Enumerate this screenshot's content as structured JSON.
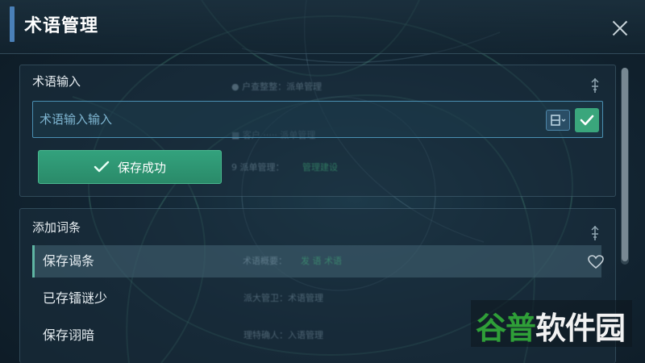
{
  "dialog": {
    "title": "术语管理",
    "close_icon": "close-icon"
  },
  "term_input_panel": {
    "title": "术语输入",
    "pin_icon": "pin-icon",
    "input": {
      "value": "",
      "placeholder": "术语输入输入"
    },
    "layout_icon": "layout-select-icon",
    "confirm_icon": "check-icon",
    "save_button_label": "保存成功"
  },
  "add_entry_panel": {
    "title": "添加词条",
    "pin_icon": "pin-icon",
    "entries": [
      {
        "label": "保存谒条",
        "active": true
      },
      {
        "label": "已存镭谜少",
        "active": false
      },
      {
        "label": "保存诩暗",
        "active": false
      }
    ],
    "favorite_icon": "heart-icon"
  },
  "watermark": {
    "text_green": "谷普",
    "text_white": "软件园"
  },
  "colors": {
    "accent_green": "#33a27d",
    "title_accent": "#4a80b8",
    "input_border": "#4a8fb2"
  }
}
